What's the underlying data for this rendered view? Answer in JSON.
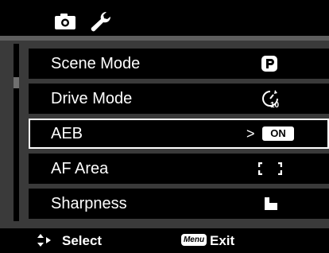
{
  "tabs": [
    {
      "name": "camera-tab"
    },
    {
      "name": "setup-tab"
    }
  ],
  "menu": {
    "items": [
      {
        "label": "Scene Mode",
        "value_icon": "scene-program-icon"
      },
      {
        "label": "Drive Mode",
        "value_icon": "self-timer-icon"
      },
      {
        "label": "AEB",
        "value_text": "ON",
        "selected": true,
        "value_icon": "on-badge"
      },
      {
        "label": "AF Area",
        "value_icon": "af-area-bracket-icon"
      },
      {
        "label": "Sharpness",
        "value_icon": "sharpness-icon"
      }
    ]
  },
  "footer": {
    "select_label": "Select",
    "menu_key": "Menu",
    "exit_label": "Exit"
  },
  "colors": {
    "background": "#000000",
    "panel": "#3a3a3a",
    "highlight": "#ffffff"
  }
}
